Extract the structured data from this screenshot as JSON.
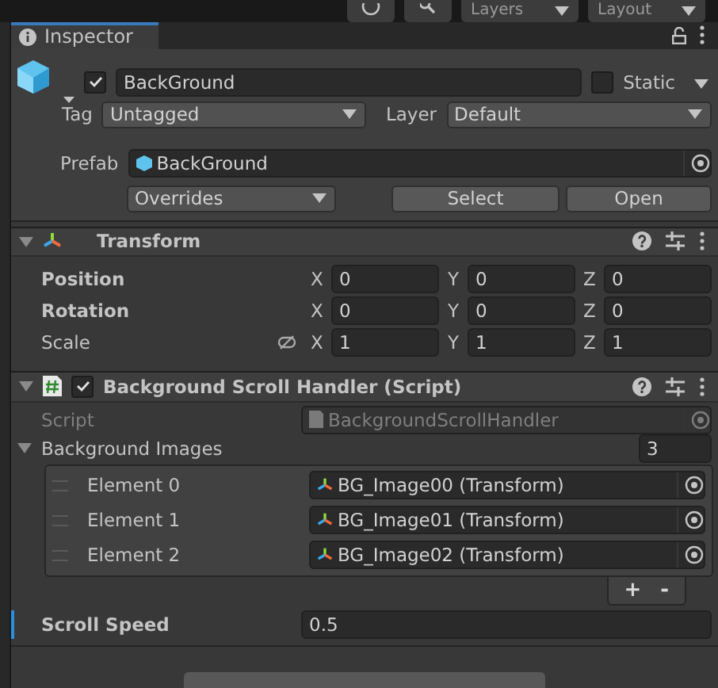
{
  "toolbar": {
    "dropdowns": [
      "Layers",
      "Layout"
    ]
  },
  "tab": {
    "label": "Inspector"
  },
  "game_object": {
    "active": true,
    "name": "BackGround",
    "static": false,
    "static_label": "Static",
    "tag_label": "Tag",
    "tag": "Untagged",
    "layer_label": "Layer",
    "layer": "Default",
    "prefab_label": "Prefab",
    "prefab": "BackGround",
    "overrides": "Overrides",
    "buttons": [
      "Select",
      "Open"
    ]
  },
  "transform": {
    "title": "Transform",
    "expanded": true,
    "rows": [
      {
        "label": "Position",
        "modified": true,
        "link_icon": false,
        "values": [
          {
            "axis": "X",
            "value": "0"
          },
          {
            "axis": "Y",
            "value": "0"
          },
          {
            "axis": "Z",
            "value": "0"
          }
        ]
      },
      {
        "label": "Rotation",
        "modified": true,
        "link_icon": false,
        "values": [
          {
            "axis": "X",
            "value": "0"
          },
          {
            "axis": "Y",
            "value": "0"
          },
          {
            "axis": "Z",
            "value": "0"
          }
        ]
      },
      {
        "label": "Scale",
        "modified": false,
        "link_icon": true,
        "values": [
          {
            "axis": "X",
            "value": "1"
          },
          {
            "axis": "Y",
            "value": "1"
          },
          {
            "axis": "Z",
            "value": "1"
          }
        ]
      }
    ]
  },
  "script_component": {
    "title": "Background Scroll Handler (Script)",
    "enabled": true,
    "expanded": true,
    "script_label": "Script",
    "script": "BackgroundScrollHandler",
    "list": {
      "label": "Background Images",
      "expanded": true,
      "count": "3",
      "elements": [
        {
          "label": "Element 0",
          "value": "BG_Image00 (Transform)"
        },
        {
          "label": "Element 1",
          "value": "BG_Image01 (Transform)"
        },
        {
          "label": "Element 2",
          "value": "BG_Image02 (Transform)"
        }
      ],
      "buttons": [
        "+",
        "-"
      ]
    },
    "fields": [
      {
        "label": "Scroll Speed",
        "value": "0.5",
        "selected": true
      }
    ]
  }
}
